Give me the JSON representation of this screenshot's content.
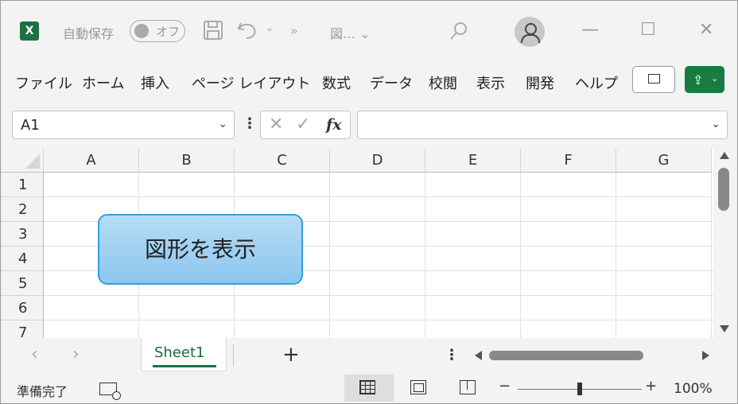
{
  "app": {
    "logo_letter": "X",
    "autosave_label": "自動保存",
    "autosave_toggle": "オフ",
    "undo_dropdown": "⌄",
    "overflow": "»",
    "title": "図… ⌄",
    "window_controls": {
      "minimize": "—",
      "maximize": "☐",
      "close": "✕"
    }
  },
  "ribbon": {
    "tabs": [
      {
        "label": "ファイル"
      },
      {
        "label": "ホーム"
      },
      {
        "label": "挿入"
      },
      {
        "label": "ページ レイアウト"
      },
      {
        "label": "数式"
      },
      {
        "label": "データ"
      },
      {
        "label": "校閲"
      },
      {
        "label": "表示"
      },
      {
        "label": "開発"
      },
      {
        "label": "ヘルプ"
      }
    ],
    "share_dropdown": "⌄"
  },
  "formula_bar": {
    "name_box": "A1",
    "formula": "",
    "cancel_symbol": "✕",
    "enter_symbol": "✓",
    "fx_label": "fx"
  },
  "grid": {
    "columns": [
      "A",
      "B",
      "C",
      "D",
      "E",
      "F",
      "G"
    ],
    "rows": [
      "1",
      "2",
      "3",
      "4",
      "5",
      "6",
      "7"
    ],
    "shape_text": "図形を表示"
  },
  "sheets": {
    "tabs": [
      "Sheet1"
    ],
    "active": "Sheet1",
    "add_label": "+"
  },
  "status": {
    "ready_text": "準備完了",
    "zoom_minus": "−",
    "zoom_plus": "+",
    "zoom_level": "100%"
  },
  "colors": {
    "excel_green": "#1d7044",
    "shape_fill": "#9fd0f2",
    "shape_border": "#30a0e0"
  }
}
